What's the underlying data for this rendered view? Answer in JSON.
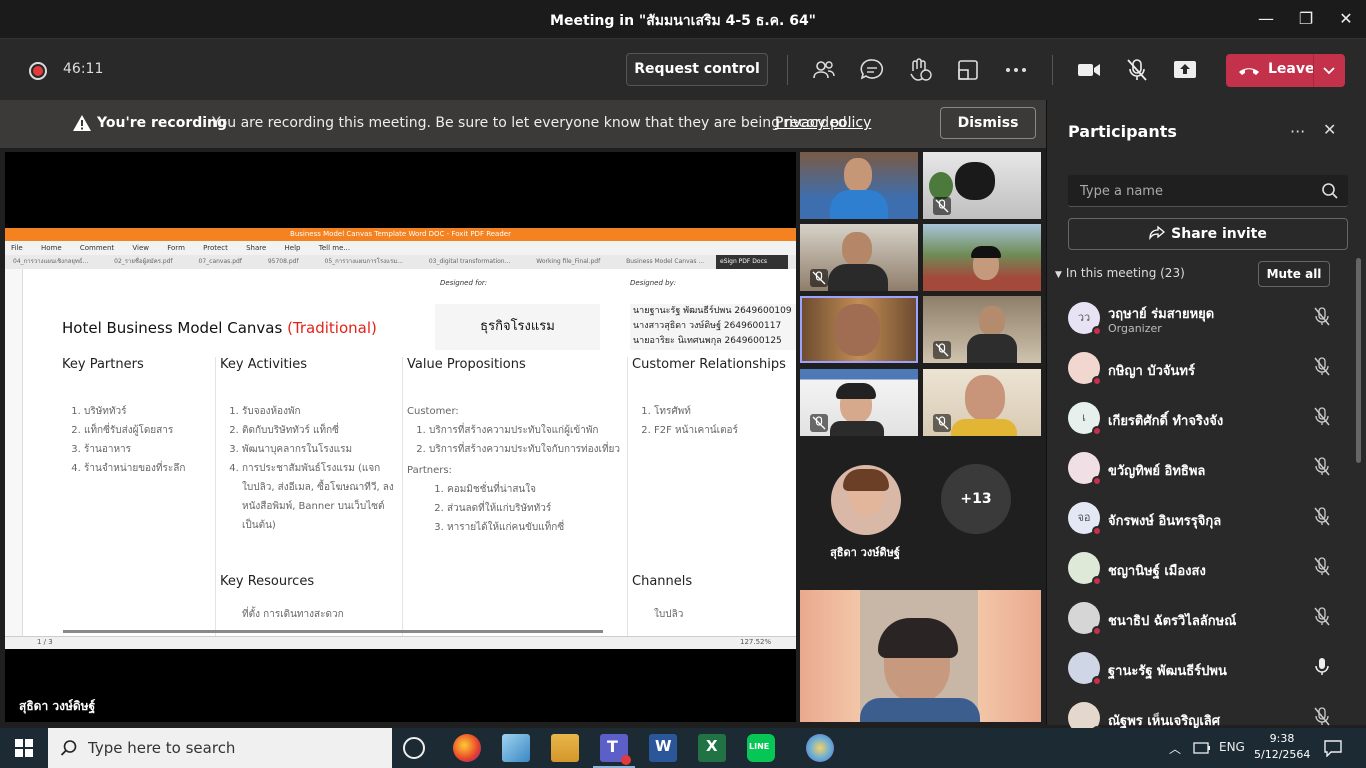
{
  "window": {
    "title": "Meeting in \"สัมมนาเสริม 4-5 ธ.ค. 64\"",
    "minimize": "—",
    "maximize": "❐",
    "close": "✕"
  },
  "toolbar": {
    "timer": "46:11",
    "request_control": "Request control",
    "leave": "Leave"
  },
  "banner": {
    "strong": "You're recording",
    "message": "You are recording this meeting. Be sure to let everyone know that they are being recorded.",
    "link": "Privacy policy",
    "dismiss": "Dismiss"
  },
  "share": {
    "app_title": "Business Model Canvas Template Word DOC - Foxit PDF Reader",
    "menu": [
      "File",
      "Home",
      "Comment",
      "View",
      "Form",
      "Protect",
      "Share",
      "Help",
      "Tell me..."
    ],
    "tabs": [
      "04_การวางแผนเชิงกลยุทธ์...",
      "02_รายชื่อผู้สมัคร.pdf",
      "07_canvas.pdf",
      "95708.pdf",
      "05_การวางแผนการโรงแรม...",
      "03_digital transformation...",
      "Working file_Final.pdf",
      "Business Model Canvas ..."
    ],
    "esign": "eSign PDF Docs",
    "designed_for_label": "Designed for:",
    "designed_by_label": "Designed by:",
    "canvas_title": "Hotel Business Model Canvas",
    "canvas_title_red": "(Traditional)",
    "business": "ธุรกิจโรงแรม",
    "designers": [
      "นายฐานะรัฐ พัฒนธีร์ปพน  2649600109",
      "นางสาวสุธิดา วงษ์ดิษฐ์  2649600117",
      "นายอาริยะ นิเทศนพกุล  2649600125"
    ],
    "key_partners": {
      "title": "Key Partners",
      "items": [
        "บริษัททัวร์",
        "แท็กซี่รับส่งผู้โดยสาร",
        "ร้านอาหาร",
        "ร้านจำหน่ายของที่ระลึก"
      ]
    },
    "key_activities": {
      "title": "Key Activities",
      "items": [
        "รับจองห้องพัก",
        "ติดกับบริษัททัวร์ แท็กซี่",
        "พัฒนาบุคลากรในโรงแรม",
        "การประชาสัมพันธ์โรงแรม (แจกใบปลิว, ส่งอีเมล, ซื้อโฆษณาทีวี, ลงหนังสือพิมพ์, Banner บนเว็บไซต์ เป็นต้น)"
      ]
    },
    "value_props": {
      "title": "Value Propositions",
      "customer_label": "Customer:",
      "customer_items": [
        "บริการที่สร้างความประทับใจแก่ผู้เข้าพัก",
        "บริการที่สร้างความประทับใจกับการท่องเที่ยว"
      ],
      "partners_label": "Partners:",
      "partner_items": [
        "คอมมิชชั่นที่น่าสนใจ",
        "ส่วนลดที่ให้แก่บริษัททัวร์",
        "หารายได้ให้แก่คนขับแท็กซี่"
      ]
    },
    "customer_rel": {
      "title": "Customer Relationships",
      "items": [
        "โทรศัพท์",
        "F2F หน้าเคาน์เตอร์"
      ]
    },
    "key_resources": {
      "title": "Key Resources",
      "first": "ที่ตั้ง การเดินทางสะดวก"
    },
    "channels": {
      "title": "Channels",
      "first": "ใบปลิว"
    },
    "page": "1 / 3",
    "zoom": "127.52%"
  },
  "stage": {
    "speaker_name": "สุธิดา วงษ์ดิษฐ์"
  },
  "grid": {
    "featured_name": "สุธิดา วงษ์ดิษฐ์",
    "overflow": "+13"
  },
  "panel": {
    "title": "Participants",
    "more": "···",
    "close": "✕",
    "search_placeholder": "Type a name",
    "share_invite": "Share invite",
    "in_meeting": "In this meeting (23)",
    "mute_all": "Mute all",
    "participants": [
      {
        "initials": "วว",
        "name": "วฤษาย์ ร่มสายหยุด",
        "role": "Organizer",
        "avatar_color": "#e8e3f4",
        "muted": true
      },
      {
        "initials": "",
        "name": "กษิญา บัวจันทร์",
        "role": "",
        "avatar_color": "#f2d7d0",
        "muted": true
      },
      {
        "initials": "เ",
        "name": "เกียรติศักดิ์ ทำจริงจัง",
        "role": "",
        "avatar_color": "#e6f0ec",
        "muted": true
      },
      {
        "initials": "",
        "name": "ขวัญทิพย์ อิทธิพล",
        "role": "",
        "avatar_color": "#f0dfe4",
        "muted": true
      },
      {
        "initials": "จอ",
        "name": "จักรพงษ์ อินทรรุจิกุล",
        "role": "",
        "avatar_color": "#e3e8f4",
        "muted": true
      },
      {
        "initials": "",
        "name": "ชญานิษฐ์ เมืองสง",
        "role": "",
        "avatar_color": "#dfe9d8",
        "muted": true
      },
      {
        "initials": "",
        "name": "ชนาธิป ฉัตรวิไลลักษณ์",
        "role": "",
        "avatar_color": "#d6d6d6",
        "muted": true
      },
      {
        "initials": "",
        "name": "ฐานะรัฐ พัฒนธีร์ปพน",
        "role": "",
        "avatar_color": "#cfd6e6",
        "muted": false
      },
      {
        "initials": "",
        "name": "ณัฐพร เห็นเจริญเลิศ",
        "role": "",
        "avatar_color": "#e4d8cc",
        "muted": true
      }
    ]
  },
  "taskbar": {
    "search_placeholder": "Type here to search",
    "lang": "ENG",
    "time": "9:38",
    "date": "5/12/2564"
  },
  "colors": {
    "accent": "#6264a7",
    "leave": "#c4314b",
    "recording": "#e03a3a",
    "canvas_red": "#e2231a"
  }
}
